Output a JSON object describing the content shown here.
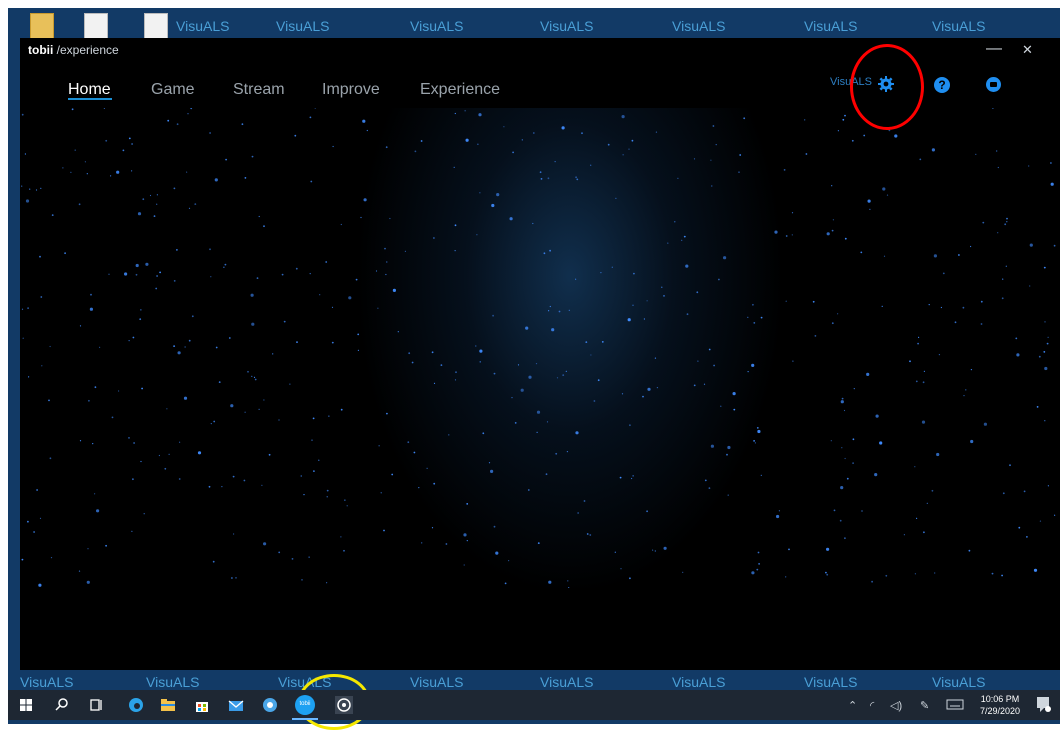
{
  "desktop": {
    "watermark": "VisuALS"
  },
  "window": {
    "brand_bold": "tobii",
    "brand_rest": " /experience",
    "minimize": "—",
    "close": "✕"
  },
  "nav": {
    "items": [
      {
        "label": "Home",
        "active": true
      },
      {
        "label": "Game",
        "active": false
      },
      {
        "label": "Stream",
        "active": false
      },
      {
        "label": "Improve",
        "active": false
      },
      {
        "label": "Experience",
        "active": false
      }
    ]
  },
  "header_right": {
    "profile_label": "VisuALS",
    "help_glyph": "?"
  },
  "taskbar": {
    "time": "10:06 PM",
    "date": "7/29/2020",
    "tobii_app_label": "tobii"
  },
  "annotations": {
    "red_circle_color": "#ff0000",
    "yellow_circle_color": "#f5e800"
  }
}
